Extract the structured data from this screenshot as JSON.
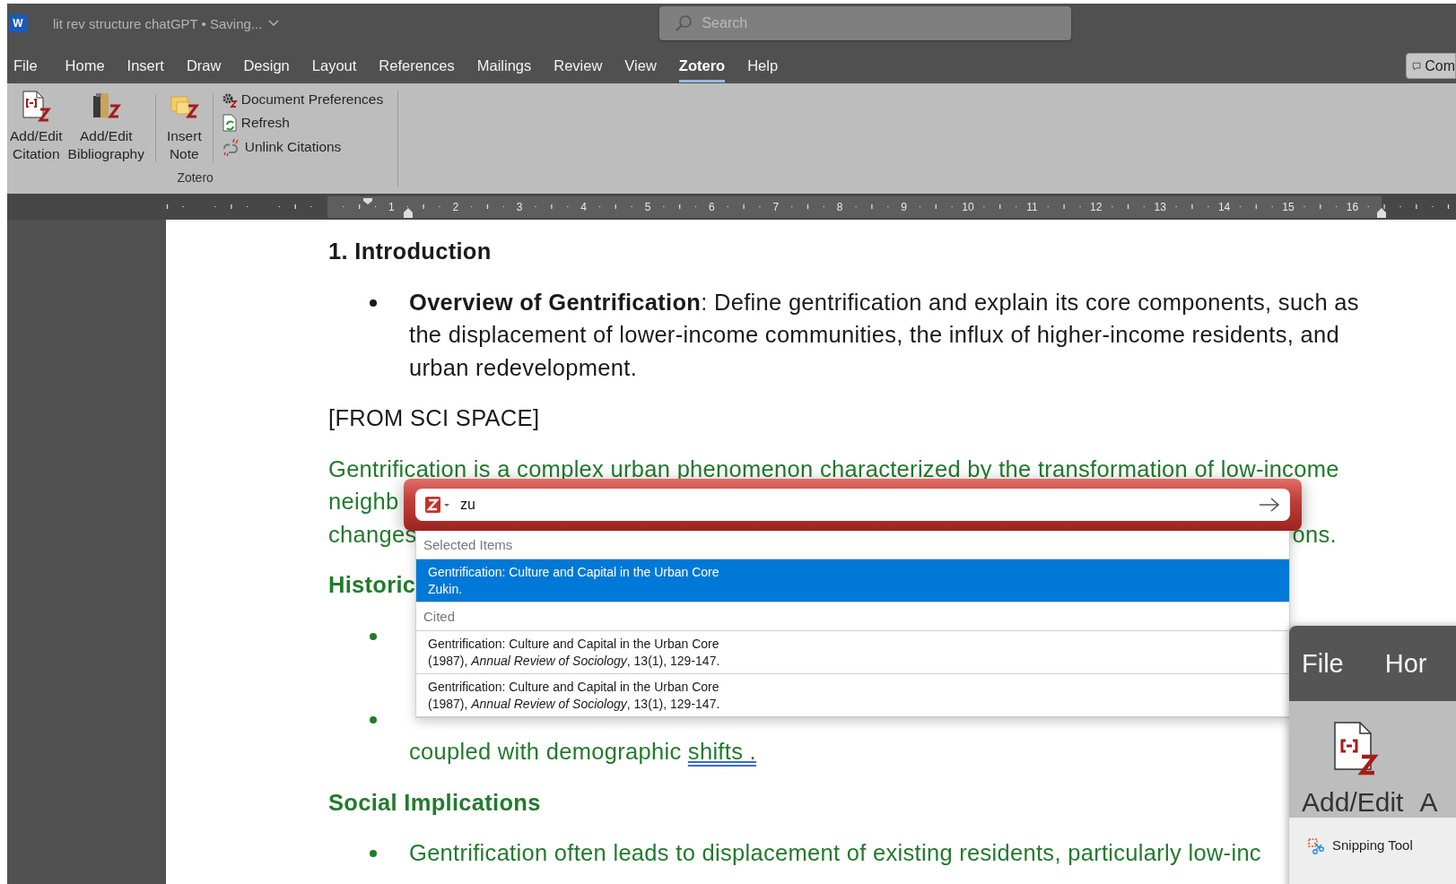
{
  "title_bar": {
    "app_letter": "W",
    "title": "lit rev structure chatGPT • Saving...",
    "search_placeholder": "Search"
  },
  "menu_tabs": [
    {
      "label": "File",
      "selected": false
    },
    {
      "label": "Home",
      "selected": false
    },
    {
      "label": "Insert",
      "selected": false
    },
    {
      "label": "Draw",
      "selected": false
    },
    {
      "label": "Design",
      "selected": false
    },
    {
      "label": "Layout",
      "selected": false
    },
    {
      "label": "References",
      "selected": false
    },
    {
      "label": "Mailings",
      "selected": false
    },
    {
      "label": "Review",
      "selected": false
    },
    {
      "label": "View",
      "selected": false
    },
    {
      "label": "Zotero",
      "selected": true
    },
    {
      "label": "Help",
      "selected": false
    }
  ],
  "comments_button": {
    "label": "Com"
  },
  "ribbon": {
    "group_label": "Zotero",
    "large_buttons": [
      {
        "kind": "citation",
        "lines": [
          "Add/Edit",
          "Citation"
        ]
      },
      {
        "kind": "bibliography",
        "lines": [
          "Add/Edit",
          "Bibliography"
        ]
      },
      {
        "kind": "note",
        "lines": [
          "Insert",
          "Note"
        ]
      }
    ],
    "small_buttons": [
      {
        "kind": "preferences",
        "label": "Document Preferences"
      },
      {
        "kind": "refresh",
        "label": "Refresh"
      },
      {
        "kind": "unlink",
        "label": "Unlink Citations"
      }
    ]
  },
  "ruler": {
    "labels": [
      "1",
      "2",
      "3",
      "4",
      "5",
      "6",
      "7",
      "8",
      "9",
      "10",
      "11",
      "12",
      "13",
      "14",
      "15",
      "16"
    ]
  },
  "document": {
    "blocks": [
      {
        "kind": "heading",
        "green": false,
        "lines": [
          [
            "1. Introduction"
          ]
        ]
      },
      {
        "kind": "bullet",
        "green": false,
        "lines": [
          [
            "**Overview of Gentrification**: Define gentrification and explain its core components, such as"
          ],
          [
            "the displacement of lower-income communities, the influx of higher-income residents, and"
          ],
          [
            "urban redevelopment."
          ]
        ]
      },
      {
        "kind": "paragraph",
        "green": false,
        "lines": [
          [
            "[FROM SCI SPACE]"
          ]
        ]
      },
      {
        "kind": "paragraph",
        "green": true,
        "lines": [
          [
            "Gentrification is a complex urban phenomenon characterized by the transformation of low-income"
          ],
          [
            "neighb"
          ],
          [
            "changes",
            "ons."
          ]
        ]
      },
      {
        "kind": "heading",
        "green": true,
        "lines": [
          [
            "Historic"
          ]
        ]
      },
      {
        "kind": "covered_bullet",
        "green": true
      },
      {
        "kind": "bullet",
        "green": true,
        "first_line_covered": true,
        "lines": [
          [
            "coupled with demographic ",
            {
              "text": "shifts .",
              "underlined": true
            }
          ]
        ]
      },
      {
        "kind": "heading",
        "green": true,
        "lines": [
          [
            "Social Implications"
          ]
        ]
      },
      {
        "kind": "bullet",
        "green": true,
        "lines": [
          [
            "Gentrification often leads to displacement of existing residents, particularly low-inc"
          ]
        ]
      }
    ]
  },
  "citation_popup": {
    "query": "zu",
    "sections": [
      {
        "header": "Selected Items",
        "items": [
          {
            "title": "Gentrification: Culture and Capital in the Urban Core",
            "detail": "Zukin.",
            "selected": true
          }
        ]
      },
      {
        "header": "Cited",
        "items": [
          {
            "title": "Gentrification: Culture and Capital in the Urban Core",
            "detail": "(1987), *Annual Review of Sociology*, 13(1), 129-147.",
            "selected": false
          },
          {
            "title": "Gentrification: Culture and Capital in the Urban Core",
            "detail": "(1987), *Annual Review of Sociology*, 13(1), 129-147.",
            "selected": false
          }
        ]
      }
    ]
  },
  "window_preview": {
    "tabs": [
      "File",
      "Hor"
    ],
    "button_label": "Add/Edit",
    "cut_label": "A",
    "app_name": "Snipping Tool"
  }
}
